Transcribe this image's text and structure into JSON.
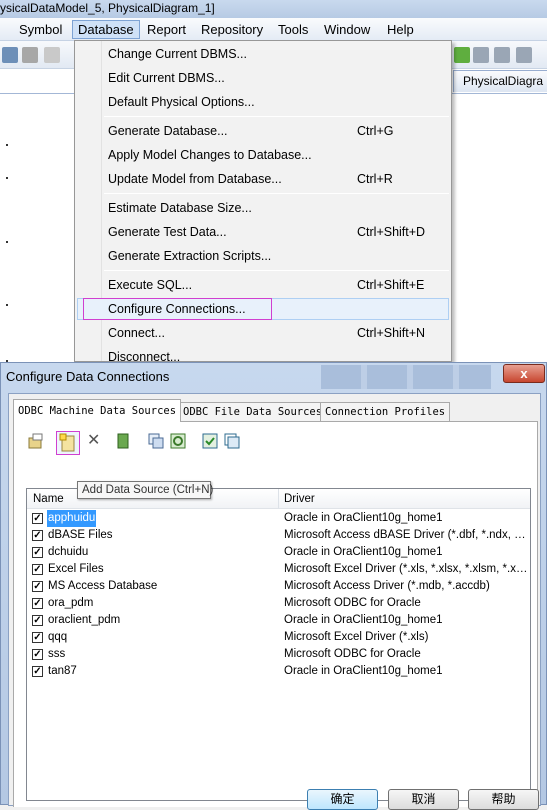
{
  "app": {
    "title": "ysicalDataModel_5, PhysicalDiagram_1]",
    "menu": [
      "Symbol",
      "Database",
      "Report",
      "Repository",
      "Tools",
      "Window",
      "Help"
    ],
    "active_menu": "Database",
    "doc_tab": "PhysicalDiagra"
  },
  "dropdown": {
    "items": [
      {
        "label": "Change Current DBMS...",
        "shortcut": ""
      },
      {
        "label": "Edit Current DBMS...",
        "shortcut": ""
      },
      {
        "label": "Default Physical Options...",
        "shortcut": ""
      },
      {
        "label": "Generate Database...",
        "shortcut": "Ctrl+G"
      },
      {
        "label": "Apply Model Changes to Database...",
        "shortcut": ""
      },
      {
        "label": "Update Model from Database...",
        "shortcut": "Ctrl+R"
      },
      {
        "label": "Estimate Database Size...",
        "shortcut": ""
      },
      {
        "label": "Generate Test Data...",
        "shortcut": "Ctrl+Shift+D"
      },
      {
        "label": "Generate Extraction Scripts...",
        "shortcut": ""
      },
      {
        "label": "Execute SQL...",
        "shortcut": "Ctrl+Shift+E"
      },
      {
        "label": "Configure Connections...",
        "shortcut": ""
      },
      {
        "label": "Connect...",
        "shortcut": "Ctrl+Shift+N"
      },
      {
        "label": "Disconnect...",
        "shortcut": ""
      }
    ]
  },
  "dialog": {
    "title": "Configure Data Connections",
    "close_label": "x",
    "tabs": [
      "ODBC Machine Data Sources",
      "ODBC File Data Sources",
      "Connection Profiles"
    ],
    "columns": {
      "name": "Name",
      "driver": "Driver"
    },
    "tooltip": "Add Data Source (Ctrl+N)",
    "rows": [
      {
        "name": "apphuidu",
        "driver": "Oracle in OraClient10g_home1",
        "checked": true
      },
      {
        "name": "dBASE Files",
        "driver": "Microsoft Access dBASE Driver (*.dbf, *.ndx, *.mdx)",
        "checked": true
      },
      {
        "name": "dchuidu",
        "driver": "Oracle in OraClient10g_home1",
        "checked": true
      },
      {
        "name": "Excel Files",
        "driver": "Microsoft Excel Driver (*.xls, *.xlsx, *.xlsm, *.xlsb)",
        "checked": true
      },
      {
        "name": "MS Access Database",
        "driver": "Microsoft Access Driver (*.mdb, *.accdb)",
        "checked": true
      },
      {
        "name": "ora_pdm",
        "driver": "Microsoft ODBC for Oracle",
        "checked": true
      },
      {
        "name": "oraclient_pdm",
        "driver": "Oracle in OraClient10g_home1",
        "checked": true
      },
      {
        "name": "qqq",
        "driver": "Microsoft Excel Driver (*.xls)",
        "checked": true
      },
      {
        "name": "sss",
        "driver": "Microsoft ODBC for Oracle",
        "checked": true
      },
      {
        "name": "tan87",
        "driver": "Oracle in OraClient10g_home1",
        "checked": true
      }
    ],
    "buttons": {
      "ok": "确定",
      "cancel": "取消",
      "help": "帮助"
    }
  }
}
